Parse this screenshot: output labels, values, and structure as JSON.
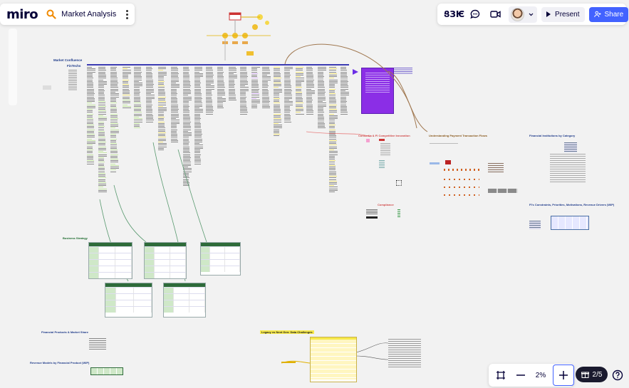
{
  "app": {
    "logo": "miro",
    "board_title": "Market Analysis"
  },
  "toolbar": {
    "reactions_text": "ՑЗѤ",
    "present_label": "Present",
    "share_label": "Share",
    "zoom_level": "2%",
    "frames_count": "2/5"
  },
  "board": {
    "labels": {
      "market_confluence": "Market Confluence",
      "fintechs": "FinTechs",
      "business_strategy": "Business Strategy",
      "consortia": "Consortia & FI Competitive Innovation",
      "payment_flows": "Understanding Payment Transaction Flows",
      "fi_by_category": "Financial Institutions by Category",
      "compliance": "Compliance",
      "fi_constraints": "FI's Constraints, Priorities, Motivations, Revenue Drivers (WIP)",
      "products_share": "Financial Products & Market Share",
      "legacy_vs_nextgen": "Legacy vs Next Gen: Data Challenges",
      "revenue_models": "Revenue Models by Financial Product (WIP)"
    }
  },
  "colors": {
    "accent_blue": "#4262ff",
    "purple_card": "#8b2ee6",
    "header_bar": "#3b3bb3",
    "label_navy": "#1f3b8a",
    "label_green": "#1d6b2e",
    "label_red": "#d14b4b",
    "label_brown": "#8a5a1e"
  }
}
